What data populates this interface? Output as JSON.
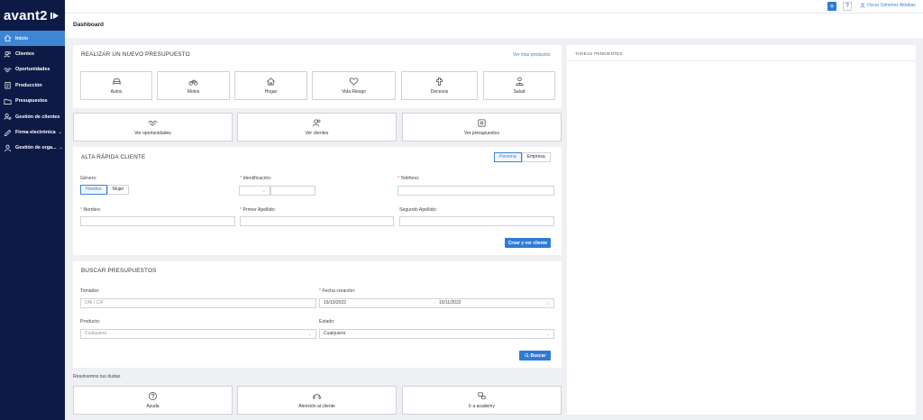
{
  "app": {
    "brand": "avant2"
  },
  "sidebar": {
    "items": [
      {
        "label": "Inicio",
        "icon": "home-icon"
      },
      {
        "label": "Clientes",
        "icon": "users-icon"
      },
      {
        "label": "Oportunidades",
        "icon": "handshake-icon"
      },
      {
        "label": "Producción",
        "icon": "clipboard-icon"
      },
      {
        "label": "Presupuestos",
        "icon": "folder-icon"
      },
      {
        "label": "Gestión de clientes",
        "icon": "user-cog-icon"
      },
      {
        "label": "Firma electrónica",
        "icon": "pen-icon"
      },
      {
        "label": "Gestión de orga...",
        "icon": "org-icon"
      }
    ]
  },
  "topbar": {
    "plus": "+",
    "help": "?",
    "user_name": "Oscar Gimenez Aldabas"
  },
  "page": {
    "title": "Dashboard"
  },
  "new_quote": {
    "title": "REALIZAR UN NUEVO PRESUPUESTO",
    "more_link": "Ver más productos",
    "products": [
      {
        "label": "Autos",
        "icon": "car-icon"
      },
      {
        "label": "Motos",
        "icon": "bike-icon"
      },
      {
        "label": "Hogar",
        "icon": "house-icon"
      },
      {
        "label": "Vida Riesgo",
        "icon": "heart-icon"
      },
      {
        "label": "Decesos",
        "icon": "cross-icon"
      },
      {
        "label": "Salud",
        "icon": "health-icon"
      }
    ]
  },
  "quick_links": [
    {
      "label": "Ver oportunidades",
      "icon": "handshake-icon"
    },
    {
      "label": "Ver clientes",
      "icon": "users-icon"
    },
    {
      "label": "Ver presupuestos",
      "icon": "document-icon"
    }
  ],
  "quick_client": {
    "title": "ALTA RÁPIDA CLIENTE",
    "type_options": [
      "Persona",
      "Empresa"
    ],
    "gender_label": "Género:",
    "gender_options": [
      "Hombre",
      "Mujer"
    ],
    "id_label": "Identificación:",
    "phone_label": "Teléfono:",
    "name_label": "Nombre:",
    "surname1_label": "Primer Apellido:",
    "surname2_label": "Segundo Apellido:",
    "submit": "Crear y ver cliente"
  },
  "search_quotes": {
    "title": "BUSCAR PRESUPUESTOS",
    "tomador_label": "Tomador:",
    "tomador_placeholder": "DNI / CIF",
    "date_label": "Fecha creación:",
    "date_from": "15/10/2022",
    "date_sep": "→",
    "date_to": "15/11/2022",
    "product_label": "Producto:",
    "product_value": "Cualquiera",
    "state_label": "Estado:",
    "state_value": "Cualquiera",
    "search_button": "Buscar"
  },
  "doubts": {
    "title": "Resolvemos tus dudas",
    "items": [
      {
        "label": "Ayuda",
        "icon": "help-icon"
      },
      {
        "label": "Atención al cliente",
        "icon": "headset-icon"
      },
      {
        "label": "Ir a academy",
        "icon": "academy-icon"
      }
    ]
  },
  "tasks": {
    "title": "TAREAS PENDIENTES"
  }
}
